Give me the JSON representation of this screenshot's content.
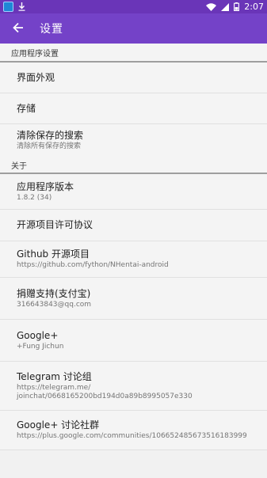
{
  "status_bar": {
    "time": "2:07",
    "bg_color": "#6a35b8"
  },
  "toolbar": {
    "title": "设置",
    "bg_color": "#7442c8"
  },
  "sections": [
    {
      "header": "应用程序设置",
      "items": [
        {
          "title": "界面外观"
        },
        {
          "title": "存储"
        },
        {
          "title": "清除保存的搜索",
          "summary": "清除所有保存的搜索"
        }
      ]
    },
    {
      "header": "关于",
      "items": [
        {
          "title": "应用程序版本",
          "summary": "1.8.2 (34)"
        },
        {
          "title": "开源项目许可协议"
        },
        {
          "title": "Github 开源项目",
          "summary": "https://github.com/fython/NHentai-android"
        },
        {
          "title": "捐赠支持(支付宝)",
          "summary": "316643843@qq.com"
        },
        {
          "title": "Google+",
          "summary": "+Fung Jichun"
        },
        {
          "title": "Telegram 讨论组",
          "summary": "https://telegram.me/",
          "summary2": "joinchat/0668165200bd194d0a89b8995057e330"
        },
        {
          "title": "Google+ 讨论社群",
          "summary": "https://plus.google.com/communities/106652485673516183999"
        }
      ]
    }
  ]
}
